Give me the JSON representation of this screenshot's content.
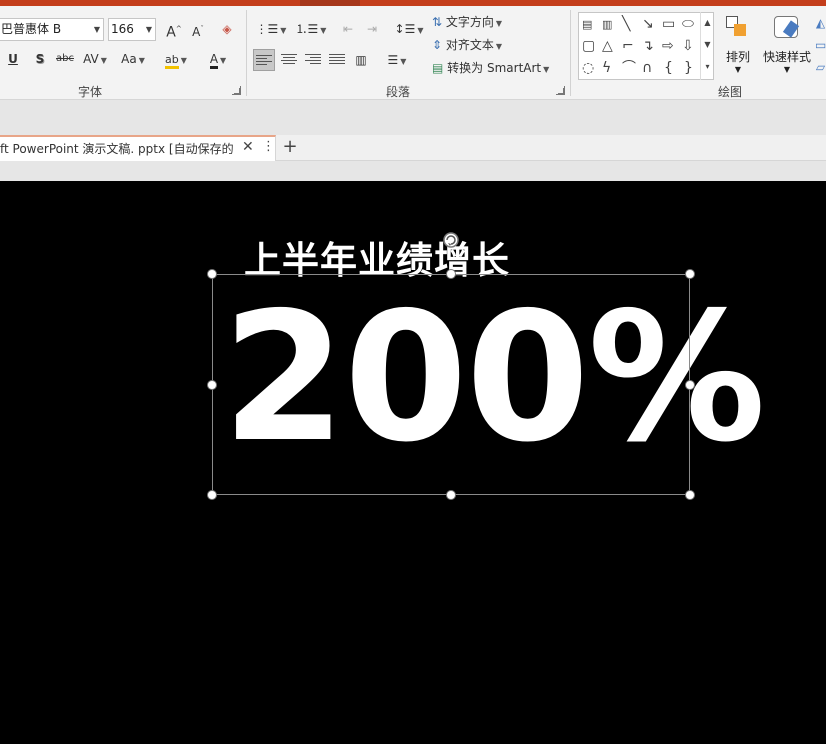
{
  "colors": {
    "accent": "#c43e1c",
    "slide_bg": "#000000",
    "slide_text": "#ffffff"
  },
  "ribbon": {
    "font_group": {
      "label": "字体",
      "font_name": "巴普惠体 B",
      "font_size": "166",
      "grow_label": "A",
      "shrink_label": "A",
      "underline_label": "U",
      "shadow_label": "S",
      "strike_label": "abc",
      "spacing_label": "AV",
      "case_label": "Aa",
      "highlight_label": "ab",
      "font_color_label": "A"
    },
    "paragraph_group": {
      "label": "段落",
      "text_direction": "文字方向",
      "align_text": "对齐文本",
      "convert_smartart": "转换为 SmartArt"
    },
    "drawing_group": {
      "label": "绘图",
      "arrange": "排列",
      "quick_styles": "快速样式"
    }
  },
  "tabs": {
    "document_title": "ft PowerPoint 演示文稿. pptx [自动保存的"
  },
  "slide": {
    "subtitle": "上半年业绩增长",
    "big_number": "200%"
  }
}
